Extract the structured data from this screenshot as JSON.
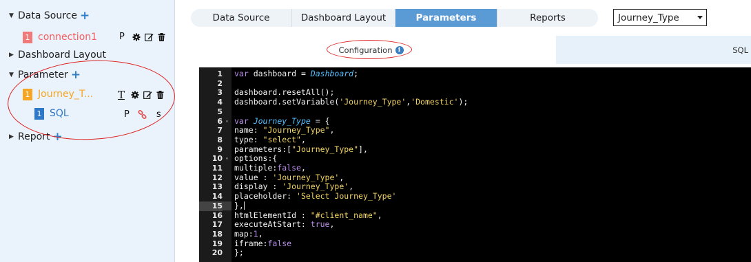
{
  "sidebar": {
    "data_source": {
      "label": "Data Source"
    },
    "connection": {
      "index": "1",
      "name": "connection1",
      "flag": "P"
    },
    "dashboard_layout": {
      "label": "Dashboard Layout"
    },
    "parameter": {
      "label": "Parameter"
    },
    "journey": {
      "index": "1",
      "name": "Journey_T...",
      "type_icon": "T"
    },
    "sql": {
      "index": "1",
      "name": "SQL",
      "flag_p": "P",
      "flag_s": "s"
    },
    "report": {
      "label": "Report"
    }
  },
  "tabs": [
    {
      "label": "Data Source"
    },
    {
      "label": "Dashboard Layout"
    },
    {
      "label": "Parameters",
      "active": true
    },
    {
      "label": "Reports"
    }
  ],
  "select": {
    "value": "Journey_Type"
  },
  "subtabs": {
    "configuration": "Configuration",
    "sql": "SQL"
  },
  "colors": {
    "accent": "#5b9bd5",
    "connection": "#f06060",
    "journey": "#f5a623",
    "sql": "#2e78c8",
    "annotation": "#dd2222"
  },
  "editor": {
    "highlighted_line": 15,
    "lines": [
      {
        "n": "1",
        "fold": false,
        "tokens": [
          [
            "kw",
            "var "
          ],
          [
            "plain",
            "dashboard = "
          ],
          [
            "var",
            "Dashboard"
          ],
          [
            "plain",
            ";"
          ]
        ]
      },
      {
        "n": "2",
        "fold": false,
        "tokens": []
      },
      {
        "n": "3",
        "fold": false,
        "tokens": [
          [
            "plain",
            "dashboard.resetAll();"
          ]
        ]
      },
      {
        "n": "4",
        "fold": false,
        "tokens": [
          [
            "plain",
            "dashboard.setVariable("
          ],
          [
            "str",
            "'Journey_Type'"
          ],
          [
            "plain",
            ","
          ],
          [
            "str",
            "'Domestic'"
          ],
          [
            "plain",
            ");"
          ]
        ]
      },
      {
        "n": "5",
        "fold": false,
        "tokens": []
      },
      {
        "n": "6",
        "fold": true,
        "tokens": [
          [
            "kw",
            "var "
          ],
          [
            "var",
            "Journey_Type"
          ],
          [
            "plain",
            " = {"
          ]
        ]
      },
      {
        "n": "7",
        "fold": false,
        "tokens": [
          [
            "plain",
            "name: "
          ],
          [
            "str",
            "\"Journey_Type\""
          ],
          [
            "plain",
            ","
          ]
        ]
      },
      {
        "n": "8",
        "fold": false,
        "tokens": [
          [
            "plain",
            "type: "
          ],
          [
            "str",
            "\"select\""
          ],
          [
            "plain",
            ","
          ]
        ]
      },
      {
        "n": "9",
        "fold": false,
        "tokens": [
          [
            "plain",
            "parameters:["
          ],
          [
            "str",
            "\"Journey_Type\""
          ],
          [
            "plain",
            "],"
          ]
        ]
      },
      {
        "n": "10",
        "fold": true,
        "tokens": [
          [
            "plain",
            "options:{"
          ]
        ]
      },
      {
        "n": "11",
        "fold": false,
        "tokens": [
          [
            "plain",
            "multiple:"
          ],
          [
            "bool",
            "false"
          ],
          [
            "plain",
            ","
          ]
        ]
      },
      {
        "n": "12",
        "fold": false,
        "tokens": [
          [
            "plain",
            "value : "
          ],
          [
            "str",
            "'Journey_Type'"
          ],
          [
            "plain",
            ","
          ]
        ]
      },
      {
        "n": "13",
        "fold": false,
        "tokens": [
          [
            "plain",
            "display : "
          ],
          [
            "str",
            "'Journey_Type'"
          ],
          [
            "plain",
            ","
          ]
        ]
      },
      {
        "n": "14",
        "fold": false,
        "tokens": [
          [
            "plain",
            "placeholder: "
          ],
          [
            "str",
            "'Select Journey_Type'"
          ]
        ]
      },
      {
        "n": "15",
        "fold": false,
        "tokens": [
          [
            "plain",
            "},"
          ]
        ]
      },
      {
        "n": "16",
        "fold": false,
        "tokens": [
          [
            "plain",
            "htmlElementId : "
          ],
          [
            "str",
            "\"#client_name\""
          ],
          [
            "plain",
            ","
          ]
        ]
      },
      {
        "n": "17",
        "fold": false,
        "tokens": [
          [
            "plain",
            "executeAtStart: "
          ],
          [
            "bool",
            "true"
          ],
          [
            "plain",
            ","
          ]
        ]
      },
      {
        "n": "18",
        "fold": false,
        "tokens": [
          [
            "plain",
            "map:"
          ],
          [
            "bool",
            "1"
          ],
          [
            "plain",
            ","
          ]
        ]
      },
      {
        "n": "19",
        "fold": false,
        "tokens": [
          [
            "plain",
            "iframe:"
          ],
          [
            "bool",
            "false"
          ]
        ]
      },
      {
        "n": "20",
        "fold": false,
        "tokens": [
          [
            "plain",
            "};"
          ]
        ]
      }
    ]
  }
}
